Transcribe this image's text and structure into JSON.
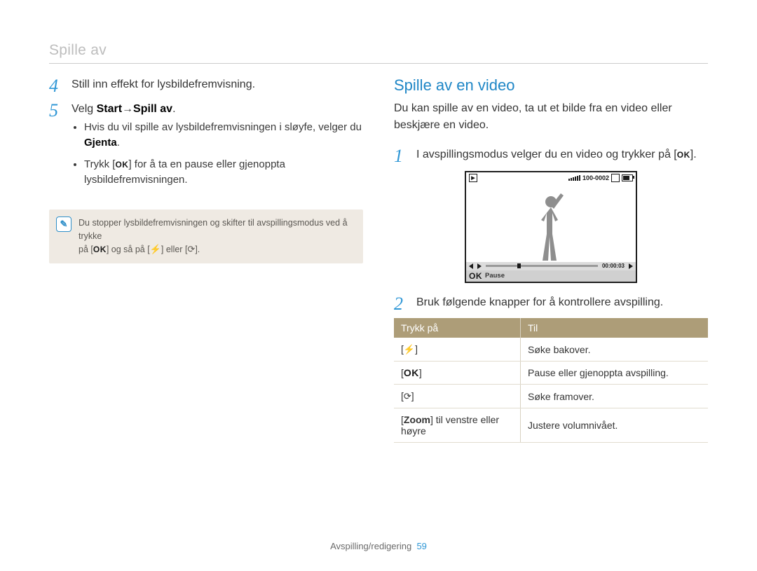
{
  "header": {
    "section_title": "Spille av"
  },
  "left": {
    "steps": [
      {
        "num": "4",
        "text": "Still inn effekt for lysbildefremvisning."
      },
      {
        "num": "5",
        "prefix": "Velg ",
        "bold1": "Start",
        "arrow": " → ",
        "bold2": "Spill av",
        "suffix": ".",
        "bullets": [
          {
            "pre": "Hvis du vil spille av lysbildefremvisningen i sløyfe, velger du ",
            "bold": "Gjenta",
            "post": "."
          },
          {
            "pre": "Trykk [",
            "ok": "OK",
            "post": "] for å ta en pause eller gjenoppta lysbildefremvisningen."
          }
        ]
      }
    ],
    "note": {
      "line1_a": "Du stopper lysbildefremvisningen og skifter til avspillingsmodus ved å trykke",
      "line2_a": "på [",
      "ok": "OK",
      "line2_b": "] og så på [",
      "icon1": "⚡",
      "line2_c": "] eller [",
      "icon2": "⟳",
      "line2_d": "]."
    }
  },
  "right": {
    "heading": "Spille av en video",
    "intro": "Du kan spille av en video, ta ut et bilde fra en video eller beskjære en video.",
    "steps": [
      {
        "num": "1",
        "pre": "I avspillingsmodus velger du en video og trykker på [",
        "ok": "OK",
        "post": "]."
      },
      {
        "num": "2",
        "text": "Bruk følgende knapper for å kontrollere avspilling."
      }
    ],
    "lcd": {
      "file_id": "100-0002",
      "time": "00:00:03",
      "status_label": "Pause",
      "ok": "OK"
    },
    "table": {
      "head": [
        "Trykk på",
        "Til"
      ],
      "rows": [
        {
          "key_pre": "[",
          "key_icon": "⚡",
          "key_post": "]",
          "val": "Søke bakover."
        },
        {
          "key_pre": "[",
          "key_ok": "OK",
          "key_post": "]",
          "val": "Pause eller gjenoppta avspilling."
        },
        {
          "key_pre": "[",
          "key_icon": "⟳",
          "key_post": "]",
          "val": "Søke framover."
        },
        {
          "key_zoom_pre": "[",
          "key_zoom_bold": "Zoom",
          "key_zoom_post": "] til venstre eller høyre",
          "val": "Justere volumnivået."
        }
      ]
    }
  },
  "footer": {
    "chapter": "Avspilling/redigering",
    "page": "59"
  }
}
